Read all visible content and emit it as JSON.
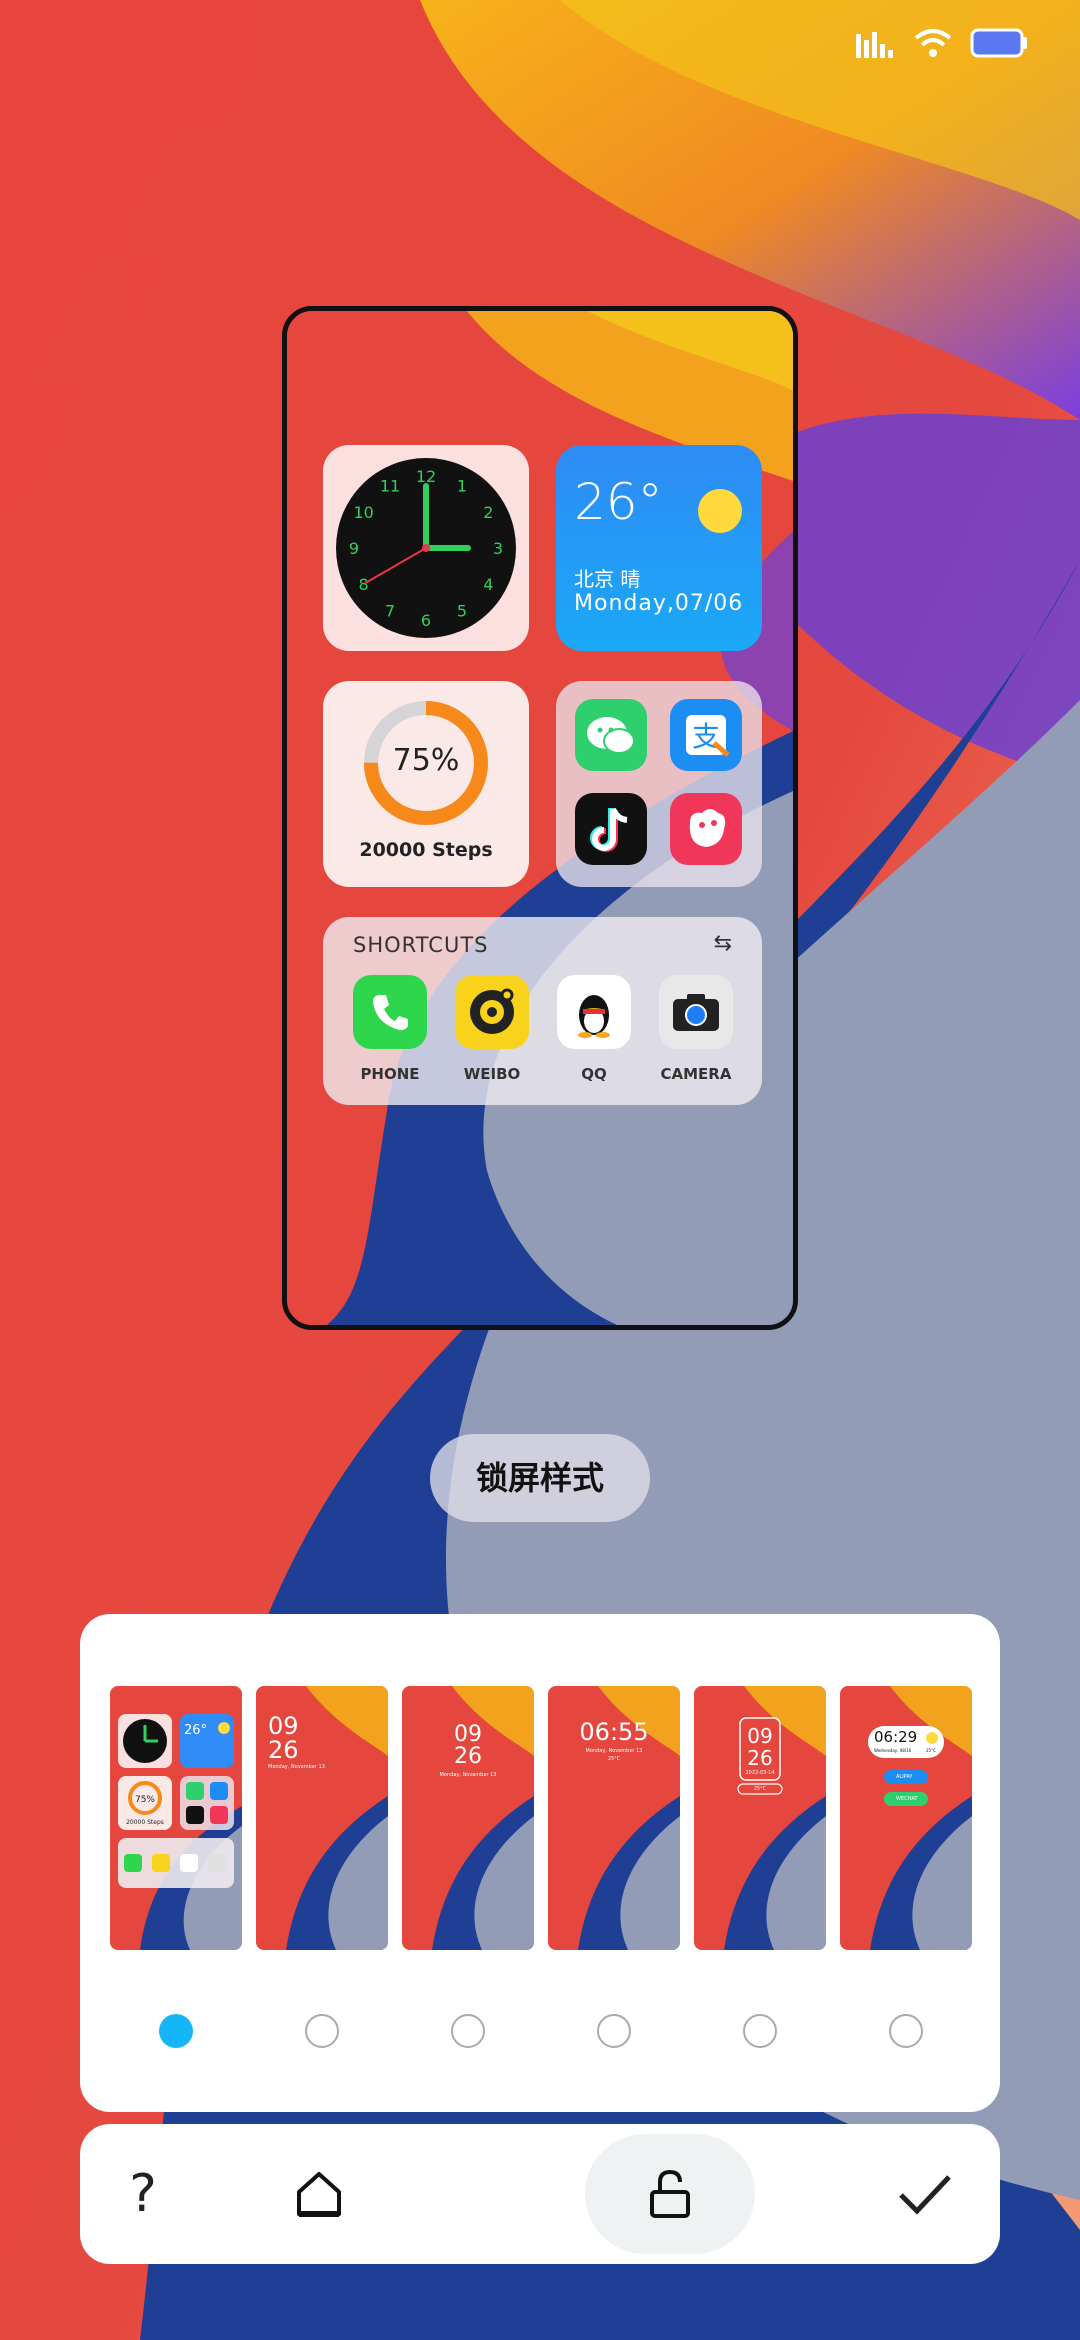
{
  "status_bar": {
    "signal_icon": "signal-icon",
    "wifi_icon": "wifi-icon",
    "battery_icon": "battery-icon"
  },
  "preview": {
    "weather": {
      "temp": "26°",
      "city": "北京 晴",
      "date": "Monday,07/06"
    },
    "steps": {
      "percent": "75%",
      "label": "20000 Steps",
      "progress": 0.75
    },
    "clock": {
      "hour": 3,
      "minute": 0,
      "second": 40
    },
    "apps": [
      "wechat-icon",
      "alipay-icon",
      "tiktok-icon",
      "app-icon"
    ],
    "shortcuts": {
      "title": "SHORTCUTS",
      "items": [
        {
          "label": "PHONE"
        },
        {
          "label": "WEIBO"
        },
        {
          "label": "QQ"
        },
        {
          "label": "CAMERA"
        }
      ]
    }
  },
  "lock_style_label": "锁屏样式",
  "thumbnails": {
    "t2": {
      "hour": "09",
      "minute": "26",
      "date": "Monday, November 13"
    },
    "t3": {
      "hour": "09",
      "minute": "26",
      "date": "Monday, November 13"
    },
    "t4": {
      "time": "06:55",
      "date": "Monday, November 13",
      "weather": "25°C"
    },
    "t5": {
      "hour": "09",
      "minute": "26",
      "date": "2022-03-14",
      "weather": "25°C"
    },
    "t6": {
      "time": "06:29",
      "date": "Wednesday, 08/16",
      "temp": "25°C",
      "pill1": "ALIPAY",
      "pill2": "WECHAT"
    },
    "selected_index": 0
  },
  "toolbar": {
    "help": "?",
    "accent": "#16b6f6"
  }
}
